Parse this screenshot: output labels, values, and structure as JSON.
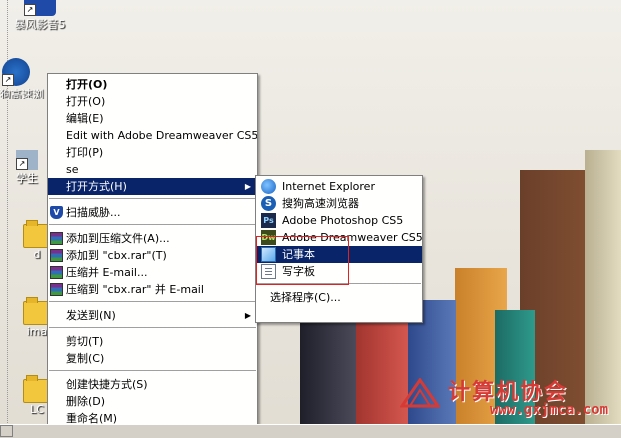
{
  "desktop": {
    "icons": [
      {
        "label": "暴风影音5"
      },
      {
        "label": "搜狗高速浏览器"
      },
      {
        "label": "学生"
      },
      {
        "label": "d"
      },
      {
        "label": "ima"
      },
      {
        "label": "LC"
      }
    ]
  },
  "context_menu": {
    "items": [
      {
        "label": "打开(O)",
        "bold": true
      },
      {
        "label": "打开(O)"
      },
      {
        "label": "编辑(E)"
      },
      {
        "label": "Edit with Adobe Dreamweaver CS5"
      },
      {
        "label": "打印(P)"
      },
      {
        "label": "se"
      },
      {
        "label": "打开方式(H)",
        "highlighted": true,
        "submenu": true
      },
      {
        "label": "扫描威胁...",
        "icon": "shield-icon"
      },
      {
        "label": "添加到压缩文件(A)...",
        "icon": "winrar-icon"
      },
      {
        "label": "添加到 \"cbx.rar\"(T)",
        "icon": "winrar-icon"
      },
      {
        "label": "压缩并 E-mail...",
        "icon": "winrar-icon"
      },
      {
        "label": "压缩到 \"cbx.rar\" 并 E-mail",
        "icon": "winrar-icon"
      },
      {
        "label": "发送到(N)",
        "submenu": true
      },
      {
        "label": "剪切(T)"
      },
      {
        "label": "复制(C)"
      },
      {
        "label": "创建快捷方式(S)"
      },
      {
        "label": "删除(D)"
      },
      {
        "label": "重命名(M)"
      }
    ]
  },
  "open_with_submenu": {
    "items": [
      {
        "label": "Internet Explorer",
        "icon": "internet-explorer-icon"
      },
      {
        "label": "搜狗高速浏览器",
        "icon": "sogou-browser-icon"
      },
      {
        "label": "Adobe Photoshop CS5",
        "icon": "photoshop-icon",
        "icon_text": "Ps"
      },
      {
        "label": "Adobe Dreamweaver CS5",
        "icon": "dreamweaver-icon",
        "icon_text": "Dw"
      },
      {
        "label": "记事本",
        "icon": "notepad-icon",
        "highlighted": true
      },
      {
        "label": "写字板",
        "icon": "wordpad-icon"
      },
      {
        "label": "选择程序(C)..."
      }
    ]
  },
  "watermark": {
    "title": "计算机协会",
    "url": "www.gxjmca.com"
  },
  "colors": {
    "highlight": "#0a246a",
    "annotation_box": "#e22222",
    "watermark": "#d63a35"
  }
}
